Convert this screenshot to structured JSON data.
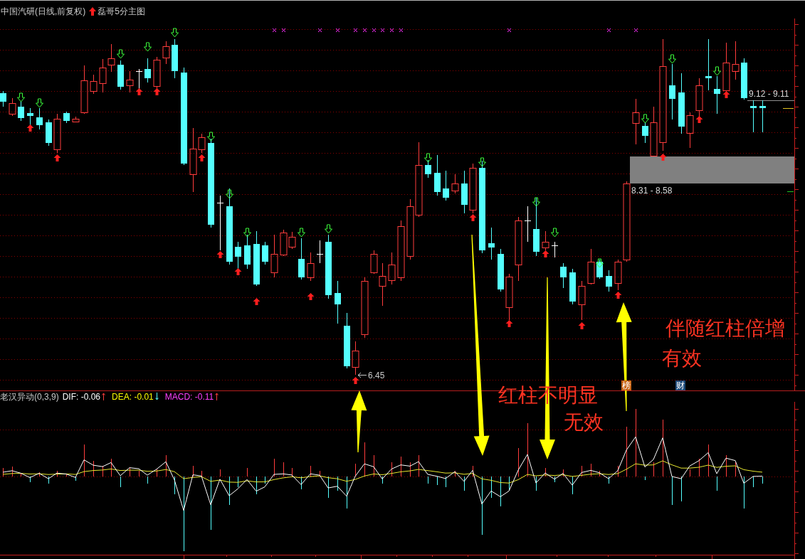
{
  "header": {
    "title": "中国汽研(日线,前复权)",
    "signal_name": "磊哥5分主图"
  },
  "main_chart": {
    "range_labels": [
      "9.12 - 9.11",
      "8.31 - 8.58"
    ],
    "low_label": "6.45",
    "badges": [
      {
        "text": "榜",
        "color": "#c86414"
      },
      {
        "text": "财",
        "color": "#1e4a7a"
      }
    ]
  },
  "indicator": {
    "name": "老汉异动(0,3,9)",
    "values": [
      {
        "text": "DIF: -0.06",
        "color": "#ffffff",
        "rising": true
      },
      {
        "text": "DEA: -0.01",
        "color": "#ffff00",
        "rising": false
      },
      {
        "text": "MACD: -0.11",
        "color": "#ff40ff",
        "rising": true
      }
    ]
  },
  "annotations": [
    "伴随红柱倍增",
    "有效",
    "红柱不明显",
    "无效"
  ]
}
